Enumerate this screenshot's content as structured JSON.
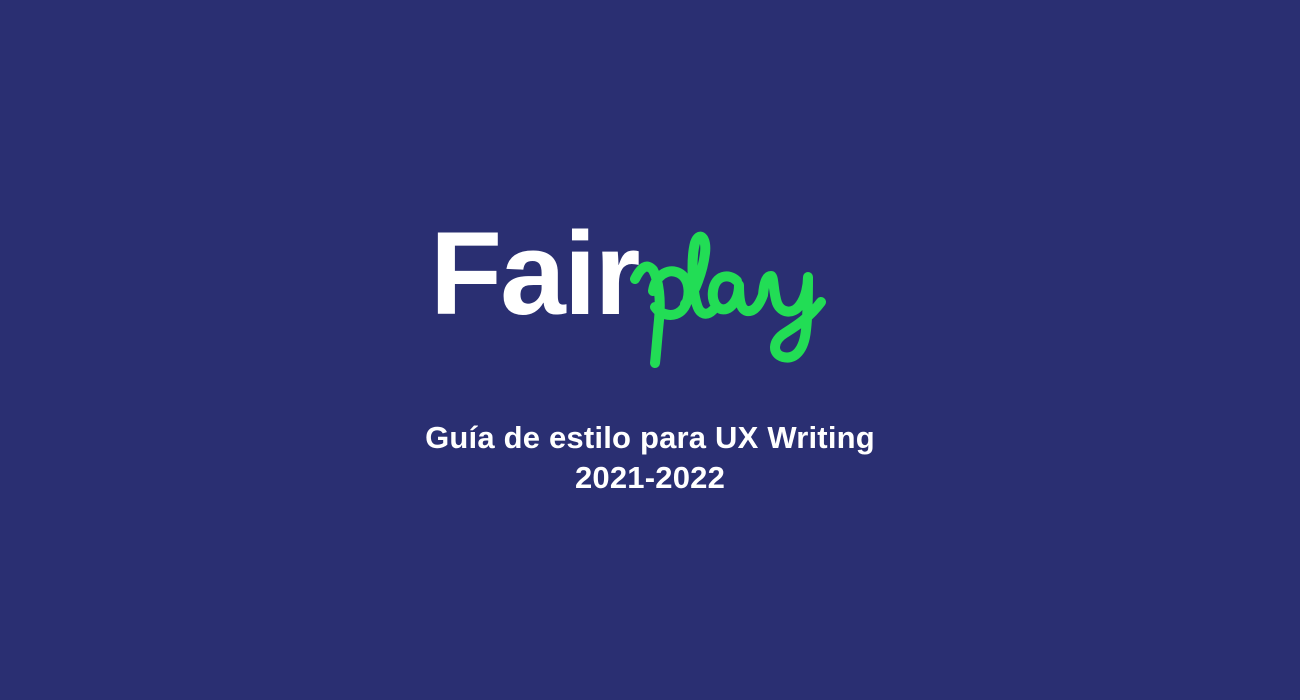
{
  "background_color": "#2a2f72",
  "logo": {
    "text_primary": "Fair",
    "text_script": "play",
    "primary_color": "#ffffff",
    "script_color": "#22dd55"
  },
  "subtitle": {
    "line1": "Guía de estilo para UX Writing",
    "line2": "2021-2022"
  }
}
